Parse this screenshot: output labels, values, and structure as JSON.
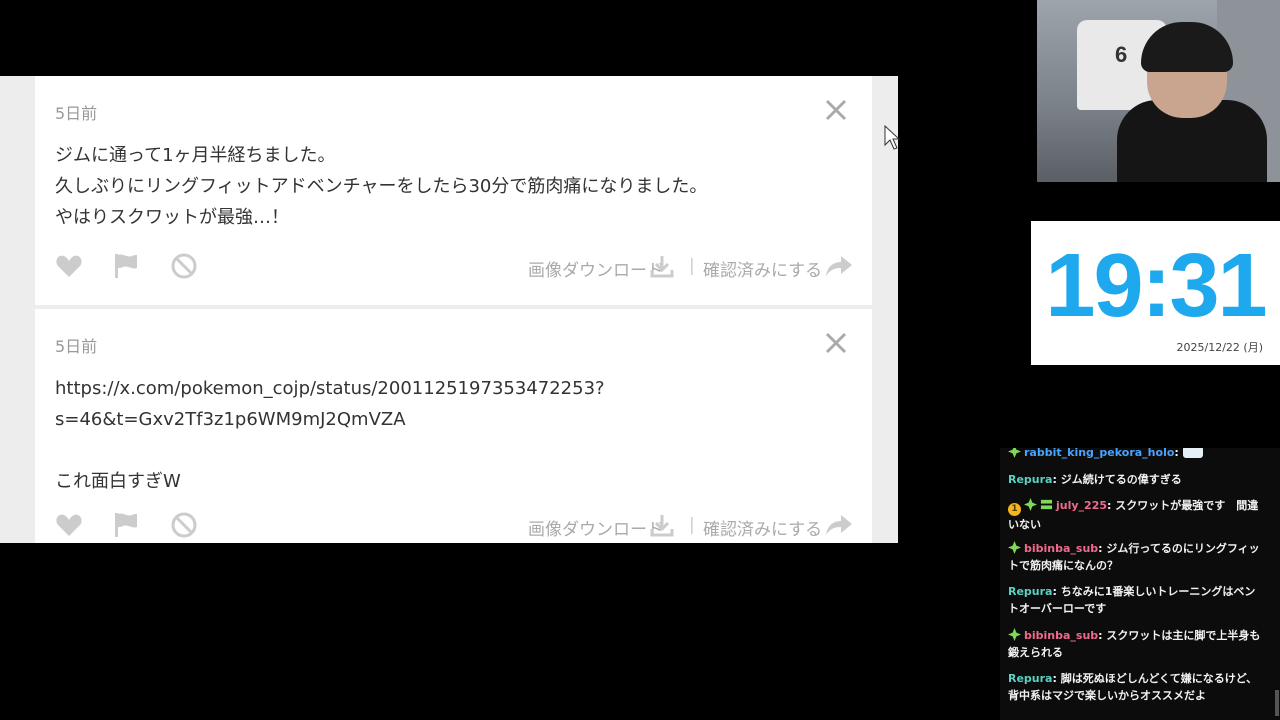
{
  "cards": [
    {
      "age": "5日前",
      "lines": [
        "ジムに通って1ヶ月半経ちました。",
        "久しぶりにリングフィットアドベンチャーをしたら30分で筋肉痛になりました。",
        "やはりスクワットが最強…！"
      ],
      "download_label": "画像ダウンロード",
      "confirm_label": "確認済みにする"
    },
    {
      "age": "5日前",
      "lines": [
        "https://x.com/pokemon_cojp/status/2001125197353472253?",
        "s=46&t=Gxv2Tf3z1p6WM9mJ2QmVZA",
        "",
        "これ面白すぎW"
      ],
      "download_label": "画像ダウンロード",
      "confirm_label": "確認済みにする"
    }
  ],
  "separator": "|",
  "webcam": {
    "jersey_number": "6"
  },
  "clock": {
    "time": "19:31",
    "date": "2025/12/22 (月)",
    "color": "#1ea8ee"
  },
  "chat": [
    {
      "name": "rabbit_king_pekora_holo",
      "text": ":"
    },
    {
      "name": "Repura",
      "text": ": ジム続けてるの偉すぎる"
    },
    {
      "coin": "1",
      "name": "july_225",
      "text": ": スクワットが最強です　間違いない"
    },
    {
      "name": "bibinba_sub",
      "text": ": ジム行ってるのにリングフィットで筋肉痛になんの？"
    },
    {
      "name": "Repura",
      "text": ": ちなみに1番楽しいトレーニングはベントオーバーローです"
    },
    {
      "name": "bibinba_sub",
      "text": ": スクワットは主に脚で上半身も鍛えられる"
    },
    {
      "name": "Repura",
      "text": ": 脚は死ぬほどしんどくて嫌になるけど、背中系はマジで楽しいからオススメだよ"
    }
  ]
}
